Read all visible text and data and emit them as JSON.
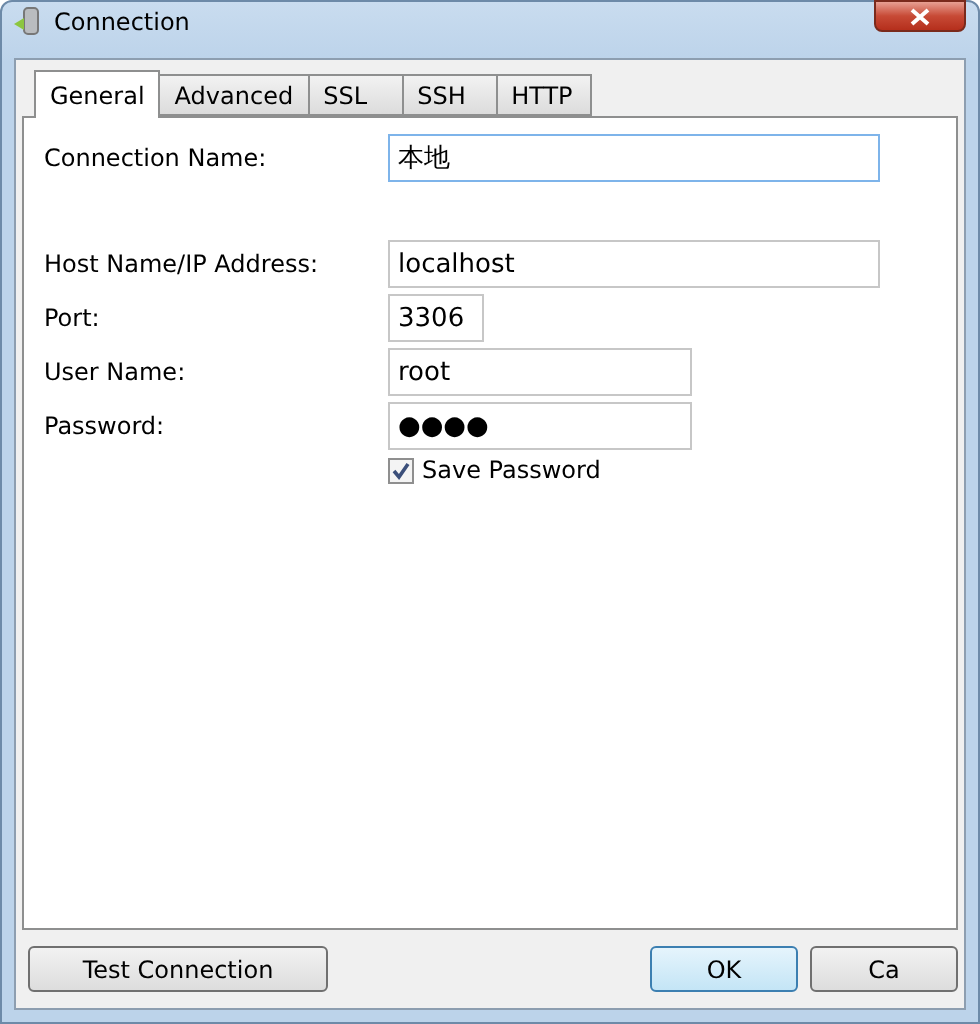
{
  "window": {
    "title": "Connection"
  },
  "tabs": [
    {
      "label": "General",
      "selected": true
    },
    {
      "label": "Advanced",
      "selected": false
    },
    {
      "label": "SSL",
      "selected": false
    },
    {
      "label": "SSH",
      "selected": false
    },
    {
      "label": "HTTP",
      "selected": false
    }
  ],
  "fields": [
    {
      "label": "Connection Name:",
      "value": "本地",
      "kind": "wide",
      "focused": true
    },
    {
      "label": "Host Name/IP Address:",
      "value": "localhost",
      "kind": "wide",
      "focused": false
    },
    {
      "label": "Port:",
      "value": "3306",
      "kind": "short",
      "focused": false
    },
    {
      "label": "User Name:",
      "value": "root",
      "kind": "medium",
      "focused": false
    },
    {
      "label": "Password:",
      "value": "●●●●",
      "kind": "medium",
      "focused": false
    }
  ],
  "save_password": {
    "label": "Save Password",
    "checked": true
  },
  "buttons": [
    {
      "label": "Test Connection",
      "default": false
    },
    {
      "label": "OK",
      "default": true
    },
    {
      "label": "Ca",
      "default": false
    }
  ]
}
